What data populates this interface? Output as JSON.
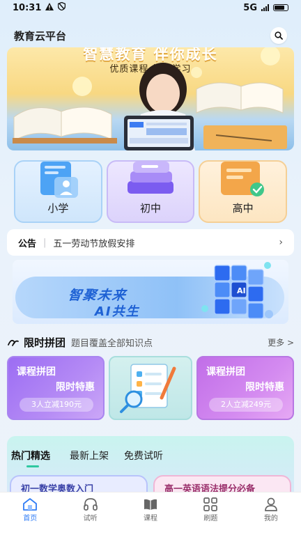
{
  "status": {
    "time": "10:31",
    "network": "5G"
  },
  "header": {
    "title": "教育云平台"
  },
  "banner": {
    "headline": "智慧教育 伴你成长",
    "subtitle": "优质课程 轻松学习"
  },
  "levels": [
    {
      "label": "小学"
    },
    {
      "label": "初中"
    },
    {
      "label": "高中"
    }
  ],
  "notice": {
    "tag": "公告",
    "text": "五一劳动节放假安排"
  },
  "ai_banner": {
    "line1": "智聚未来",
    "line2": "AI共生",
    "badge": "AI"
  },
  "group_buy": {
    "title": "限时拼团",
    "subtitle": "题目覆盖全部知识点",
    "more": "更多 >",
    "cards": [
      {
        "title": "课程拼团",
        "sub": "限时特惠",
        "deal": "3人立减190元"
      },
      {
        "title": "课程拼团",
        "sub": "限时特惠",
        "deal": "2人立减249元"
      }
    ]
  },
  "hot": {
    "tabs": [
      "热门精选",
      "最新上架",
      "免费试听"
    ],
    "cards": [
      {
        "title": "初一数学奥数入门"
      },
      {
        "title": "高一英语语法提分必备"
      }
    ]
  },
  "tabbar": [
    {
      "label": "首页",
      "icon": "home-icon"
    },
    {
      "label": "试听",
      "icon": "headphones-icon"
    },
    {
      "label": "课程",
      "icon": "book-icon"
    },
    {
      "label": "刷题",
      "icon": "grid-icon"
    },
    {
      "label": "我的",
      "icon": "person-icon"
    }
  ],
  "colors": {
    "accent": "#2f7cf6",
    "hot_underline": "#2ec8a0"
  }
}
